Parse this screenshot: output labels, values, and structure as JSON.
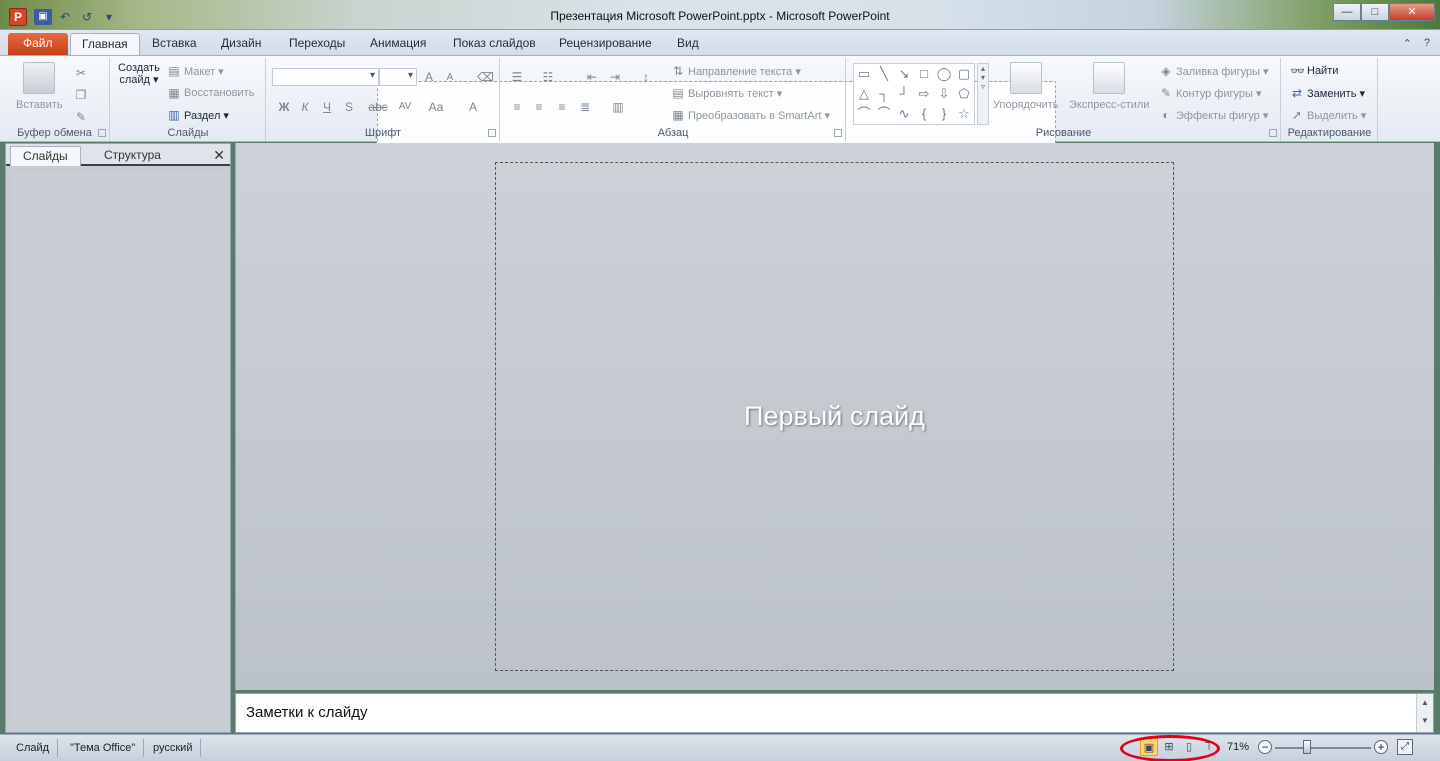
{
  "window": {
    "title": "Презентация Microsoft PowerPoint.pptx - Microsoft PowerPoint",
    "app_icon_letter": "P",
    "controls": {
      "minimize": "—",
      "maximize": "□",
      "close": "✕"
    }
  },
  "quick_access": {
    "save": "▣",
    "undo": "↶",
    "redo": "↺",
    "customize": "▾"
  },
  "tabs": {
    "file": "Файл",
    "home": "Главная",
    "insert": "Вставка",
    "design": "Дизайн",
    "transitions": "Переходы",
    "animation": "Анимация",
    "slideshow": "Показ слайдов",
    "review": "Рецензирование",
    "view": "Вид",
    "collapse": "⌃",
    "help": "?"
  },
  "ribbon": {
    "clipboard": {
      "label": "Буфер обмена",
      "paste": "Вставить"
    },
    "slides": {
      "label": "Слайды",
      "new_slide_1": "Создать",
      "new_slide_2": "слайд ▾",
      "layout": "Макет ▾",
      "reset": "Восстановить",
      "section": "Раздел ▾"
    },
    "font": {
      "label": "Шрифт",
      "bold": "Ж",
      "italic": "К",
      "underline": "Ч",
      "shadow": "S",
      "strike": "abc",
      "spacing": "AV",
      "case": "Aa",
      "color": "A",
      "grow": "A",
      "shrink": "A"
    },
    "paragraph": {
      "label": "Абзац",
      "text_direction": "Направление текста ▾",
      "align_text": "Выровнять текст ▾",
      "smartart": "Преобразовать в SmartArt ▾"
    },
    "drawing": {
      "label": "Рисование",
      "arrange": "Упорядочить",
      "quick_styles": "Экспресс-стили",
      "fill": "Заливка фигуры ▾",
      "outline": "Контур фигуры ▾",
      "effects": "Эффекты фигур ▾"
    },
    "editing": {
      "label": "Редактирование",
      "find": "Найти",
      "replace": "Заменить ▾",
      "select": "Выделить ▾"
    }
  },
  "left_pane": {
    "tab_slides": "Слайды",
    "tab_outline": "Структура",
    "close": "✕"
  },
  "slide": {
    "title": "Первый слайд"
  },
  "notes": {
    "placeholder": "Заметки к слайду"
  },
  "statusbar": {
    "slide": "Слайд",
    "theme": "\"Тема Office\"",
    "language": "русский",
    "zoom": "71%",
    "zoom_minus": "−",
    "zoom_plus": "+",
    "fit": "⤢",
    "view_normal": "▣",
    "view_sorter": "⊞",
    "view_reading": "▯",
    "view_slideshow": "⊤"
  },
  "colors": {
    "file_tab": "#d24726",
    "highlight_ring": "#e0001a",
    "active_view": "#ffd36b"
  }
}
